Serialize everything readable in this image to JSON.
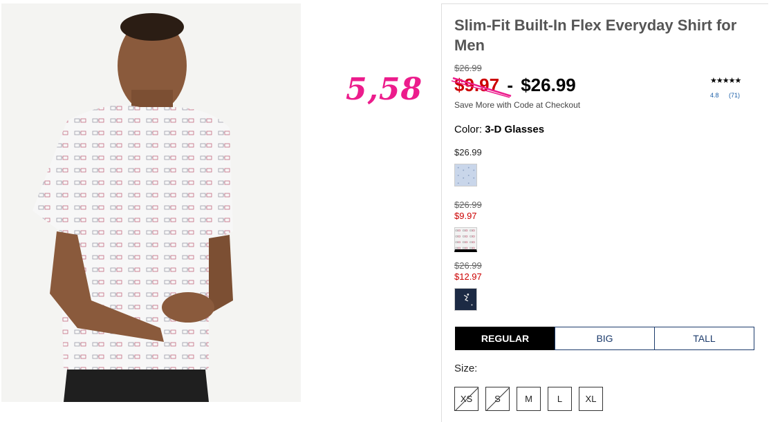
{
  "handwritten_note": "5,58",
  "product": {
    "title": "Slim-Fit Built-In Flex Everyday Shirt for Men",
    "original_price": "$26.99",
    "sale_price": "$9.97",
    "price_separator": "-",
    "max_price": "$26.99",
    "promo_text": "Save More with Code at Checkout",
    "rating": {
      "stars": "★★★★★",
      "value": "4.8",
      "count": "(71)"
    },
    "color_prefix": "Color:",
    "color_name": "3-D Glasses",
    "swatches": [
      {
        "price": "$26.99",
        "old_price": "",
        "sale_price": "",
        "name": "light-blue-dot-swatch",
        "fill": "#c9d6ea"
      },
      {
        "price": "",
        "old_price": "$26.99",
        "sale_price": "$9.97",
        "name": "3d-glasses-white-swatch",
        "fill": "#f2f2f2"
      },
      {
        "price": "",
        "old_price": "$26.99",
        "sale_price": "$12.97",
        "name": "navy-print-swatch",
        "fill": "#1c2a44"
      }
    ],
    "fit_tabs": [
      "REGULAR",
      "BIG",
      "TALL"
    ],
    "size_label": "Size:",
    "sizes": [
      {
        "label": "XS",
        "available": false
      },
      {
        "label": "S",
        "available": false
      },
      {
        "label": "M",
        "available": true
      },
      {
        "label": "L",
        "available": true
      },
      {
        "label": "XL",
        "available": true
      }
    ]
  },
  "colors": {
    "sale_red": "#cc0000",
    "accent_pink": "#ec1c8c",
    "link_blue": "#1b5fa8",
    "tab_navy": "#1b3a6b"
  }
}
